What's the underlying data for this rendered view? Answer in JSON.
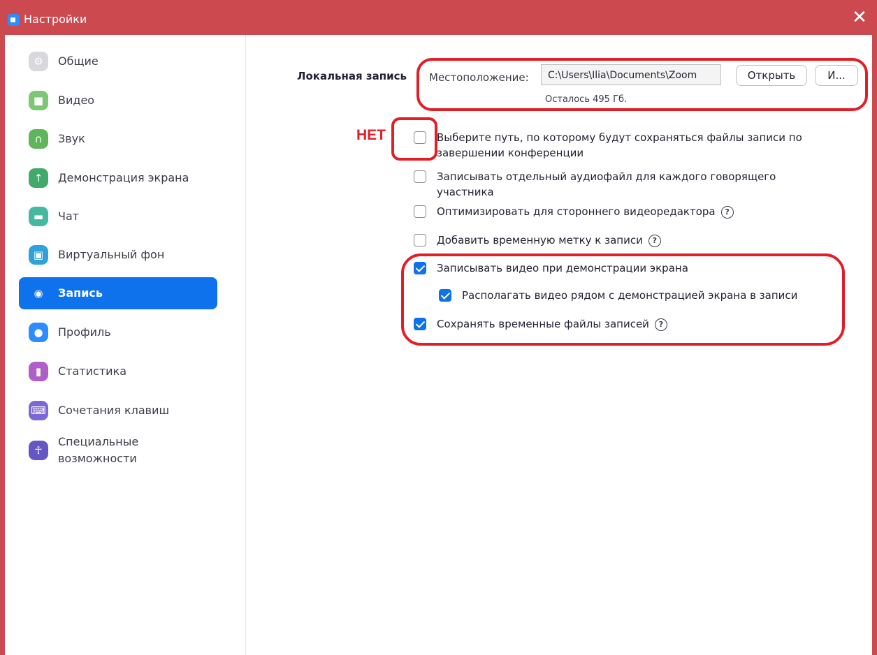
{
  "window": {
    "title": "Настройки",
    "close_glyph": "✕"
  },
  "sidebar": {
    "items": [
      {
        "label": "Общие",
        "icon": "gear-icon",
        "color": "#d8d8dd",
        "glyph": "⚙"
      },
      {
        "label": "Видео",
        "icon": "video-camera-icon",
        "color": "#7cc773",
        "glyph": "■"
      },
      {
        "label": "Звук",
        "icon": "headphones-icon",
        "color": "#5fb65a",
        "glyph": "∩"
      },
      {
        "label": "Демонстрация экрана",
        "icon": "share-screen-icon",
        "color": "#3faa6a",
        "glyph": "↑"
      },
      {
        "label": "Чат",
        "icon": "chat-bubble-icon",
        "color": "#45b8a2",
        "glyph": "▬"
      },
      {
        "label": "Виртуальный фон",
        "icon": "person-background-icon",
        "color": "#2fa3d9",
        "glyph": "▣"
      },
      {
        "label": "Запись",
        "icon": "record-icon",
        "color": "#0e72ed",
        "glyph": "◉",
        "active": true
      },
      {
        "label": "Профиль",
        "icon": "profile-icon",
        "color": "#2d8cff",
        "glyph": "●"
      },
      {
        "label": "Статистика",
        "icon": "statistics-icon",
        "color": "#b05fc9",
        "glyph": "▮"
      },
      {
        "label": "Сочетания клавиш",
        "icon": "keyboard-icon",
        "color": "#7b68d6",
        "glyph": "⌨"
      },
      {
        "label": "Специальные возможности",
        "icon": "accessibility-icon",
        "color": "#6257c4",
        "glyph": "☥"
      }
    ]
  },
  "recording": {
    "section_label": "Локальная запись",
    "location_label": "Местоположение:",
    "path_value": "C:\\Users\\Ilia\\Documents\\Zoom",
    "open_button": "Открыть",
    "more_button": "И...",
    "free_space": "Осталось 495 Гб.",
    "options": [
      {
        "text": "Выберите путь, по которому будут сохраняться файлы записи по завершении конференции",
        "checked": false
      },
      {
        "text": "Записывать отдельный аудиофайл для каждого говорящего участника",
        "checked": false
      },
      {
        "text": "Оптимизировать для стороннего видеоредактора",
        "checked": false,
        "help": "?"
      },
      {
        "text": "Добавить временную метку к записи",
        "checked": false,
        "help": "?"
      },
      {
        "text": "Записывать видео при демонстрации экрана",
        "checked": true
      },
      {
        "text": "Располагать видео рядом с демонстрацией экрана в записи",
        "checked": true
      },
      {
        "text": "Сохранять временные файлы записей",
        "checked": true,
        "help": "?"
      }
    ]
  },
  "annotations": {
    "no_label": "НЕТ",
    "color": "#e21e26"
  }
}
